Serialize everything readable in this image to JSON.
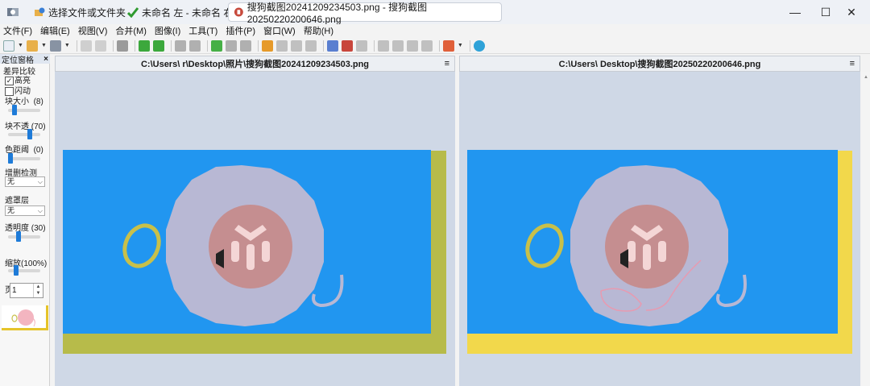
{
  "tabs": [
    {
      "label": "选择文件或文件夹",
      "icon": "folder-globe-icon"
    },
    {
      "label": "未命名 左 - 未命名 右",
      "icon": "compare-check-icon"
    },
    {
      "label": "搜狗截图20241209234503.png - 搜狗截图20250220200646.png",
      "icon": "image-compare-icon"
    }
  ],
  "window": {
    "minimize": "—",
    "maximize": "☐",
    "close": "✕"
  },
  "menu": [
    "文件(F)",
    "编辑(E)",
    "视图(V)",
    "合并(M)",
    "图像(I)",
    "工具(T)",
    "插件(P)",
    "窗口(W)",
    "帮助(H)"
  ],
  "left_panel": {
    "title": "定位窗格",
    "close": "×",
    "diff_group": "差异比较",
    "highlight_label": "高亮",
    "highlight_checked": true,
    "blink_label": "闪动",
    "blink_checked": false,
    "block_size_label": "块大小",
    "block_size_value": "(8)",
    "block_size_level": 0.15,
    "block_opacity_label": "块不透",
    "block_opacity_value": "(70)",
    "block_opacity_level": 0.7,
    "color_distance_label": "色距阈",
    "color_distance_value": "(0)",
    "color_distance_level": 0.0,
    "insert_detect_label": "增删检测",
    "insert_detect_select": "无",
    "overlay_group": "遮罩层",
    "overlay_select": "无",
    "transparency_label": "透明度",
    "transparency_value": "(30)",
    "transparency_level": 0.3,
    "zoom_label": "缩放(100%)",
    "zoom_level": 0.2,
    "page_label": "页",
    "page_value": "1",
    "spin_up": "▲",
    "spin_down": "▼"
  },
  "left_image": {
    "path": "C:\\Users\\        r\\Desktop\\照片\\搜狗截图20241209234503.png",
    "menu": "≡"
  },
  "right_image": {
    "path": "C:\\Users\\          Desktop\\搜狗截图20250220200646.png",
    "menu": "≡"
  },
  "colors": {
    "blue": "#2196f0",
    "olive": "#b7bb4a",
    "yellow": "#f2d84b",
    "halo": "#b8b8d4",
    "center": "#c58e90",
    "pane_bg": "#cfd8e6"
  }
}
